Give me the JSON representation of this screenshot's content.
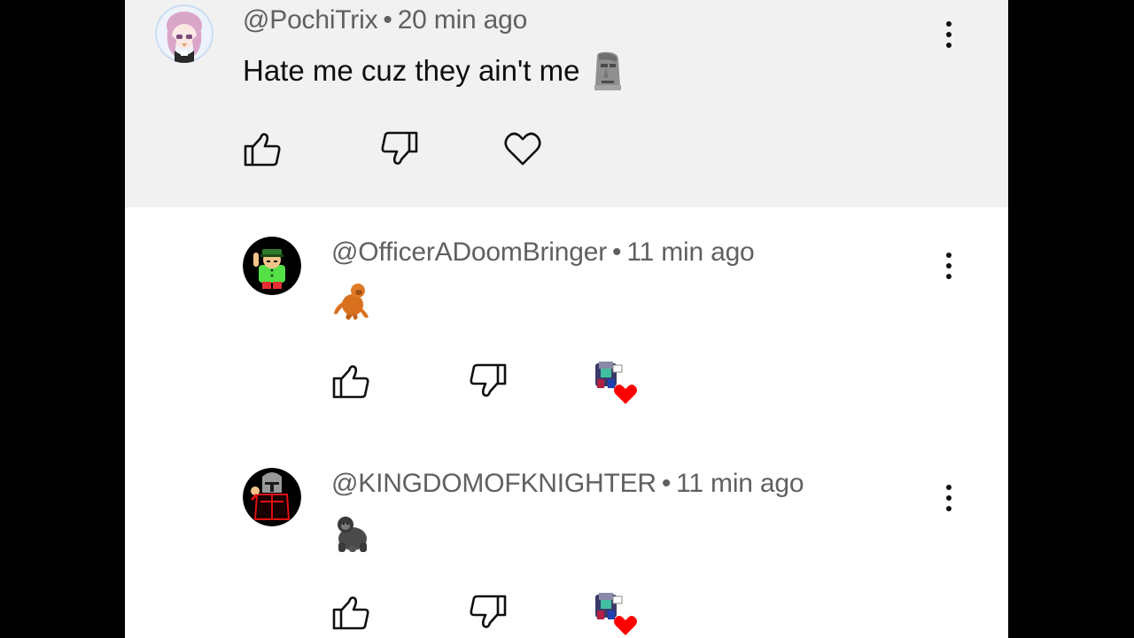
{
  "comments": [
    {
      "handle": "@PochiTrix",
      "separator": "•",
      "time": "20 min ago",
      "text": "Hate me cuz they ain't me",
      "emoji": "moai-emoji",
      "highlighted": true,
      "hearted_by_creator": false
    },
    {
      "handle": "@OfficerADoomBringer",
      "separator": "•",
      "time": "11 min ago",
      "text": "",
      "emoji": "orangutan-emoji",
      "highlighted": false,
      "hearted_by_creator": true
    },
    {
      "handle": "@KINGDOMOFKNIGHTER",
      "separator": "•",
      "time": "11 min ago",
      "text": "",
      "emoji": "gorilla-emoji",
      "highlighted": false,
      "hearted_by_creator": true
    }
  ],
  "icons": {
    "like": "thumbs-up-icon",
    "dislike": "thumbs-down-icon",
    "heart": "heart-outline-icon",
    "creator_heart": "creator-heart-badge",
    "more": "more-vertical-icon"
  },
  "colors": {
    "highlight_bg": "#f1f1f1",
    "meta_text": "#606060",
    "body_text": "#0f0f0f",
    "heart_red": "#ff0000",
    "letterbox": "#000000"
  }
}
